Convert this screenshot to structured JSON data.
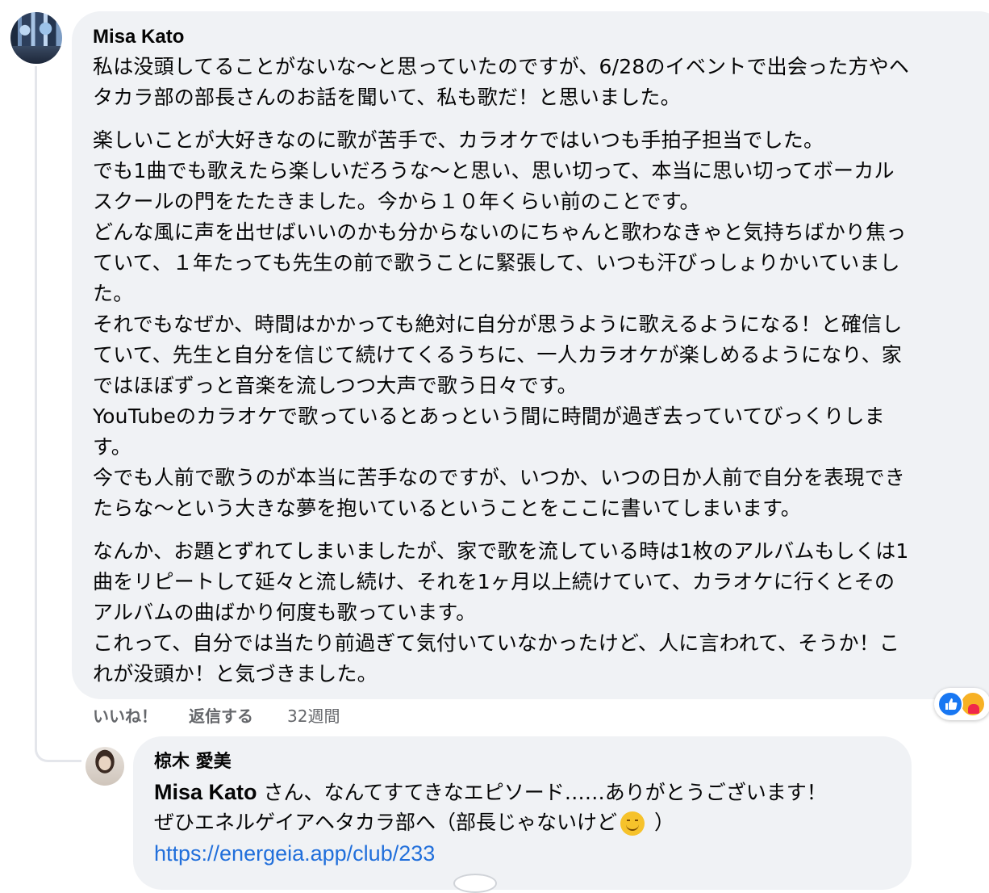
{
  "comment": {
    "author": "Misa Kato",
    "lines": [
      "私は没頭してることがないな〜と思っていたのですが、6/28のイベントで出会った方やヘ",
      "タカラ部の部長さんのお話を聞いて、私も歌だ！と思いました。",
      "楽しいことが大好きなのに歌が苦手で、カラオケではいつも手拍子担当でした。",
      "でも1曲でも歌えたら楽しいだろうな〜と思い、思い切って、本当に思い切ってボーカル",
      "スクールの門をたたきました。今から１０年くらい前のことです。",
      "どんな風に声を出せばいいのかも分からないのにちゃんと歌わなきゃと気持ちばかり焦っ",
      "ていて、１年たっても先生の前で歌うことに緊張して、いつも汗びっしょりかいていまし",
      "た。",
      "それでもなぜか、時間はかかっても絶対に自分が思うように歌えるようになる！と確信し",
      "ていて、先生と自分を信じて続けてくるうちに、一人カラオケが楽しめるようになり、家",
      "ではほぼずっと音楽を流しつつ大声で歌う日々です。",
      "YouTubeのカラオケで歌っているとあっという間に時間が過ぎ去っていてびっくりしま",
      "す。",
      "今でも人前で歌うのが本当に苦手なのですが、いつか、いつの日か人前で自分を表現でき",
      "たらな〜という大きな夢を抱いているということをここに書いてしまいます。",
      "なんか、お題とずれてしまいましたが、家で歌を流している時は1枚のアルバムもしくは1",
      "曲をリピートして延々と流し続け、それを1ヶ月以上続けていて、カラオケに行くとその",
      "アルバムの曲ばかり何度も歌っています。",
      "これって、自分では当たり前過ぎて気付いていなかったけど、人に言われて、そうか！こ",
      "れが没頭か！と気づきました。"
    ],
    "actions": {
      "like": "いいね！",
      "reply": "返信する",
      "time": "32週間"
    }
  },
  "reply": {
    "author": "椋木 愛美",
    "mention": "Misa Kato",
    "line1_rest": " さん、なんてすてきなエピソード……ありがとうございます！",
    "line2_before": "ぜひエネルゲイアヘタカラ部へ（部長じゃないけど",
    "line2_after": " ）",
    "link": "https://energeia.app/club/233"
  },
  "icons": {
    "reaction_like": "like-icon",
    "reaction_care": "care-icon",
    "emoji": "smiling-face-emoji"
  }
}
